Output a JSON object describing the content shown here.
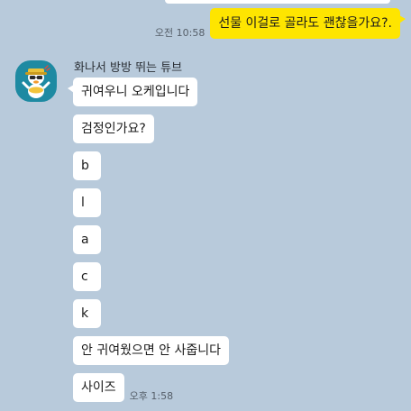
{
  "outgoing": {
    "time": "오전 10:58",
    "text": "선물 이걸로 골라도 괜찮을가요?."
  },
  "incoming": {
    "sender": "화나서 방방 뛰는 튜브",
    "avatar_icon": "tube-character-avatar-icon",
    "messages": [
      {
        "text": "귀여우니 오케입니다"
      },
      {
        "text": "검정인가요?"
      },
      {
        "text": "b"
      },
      {
        "text": "l"
      },
      {
        "text": "a"
      },
      {
        "text": "c"
      },
      {
        "text": "k"
      },
      {
        "text": "안 귀여웠으면 안 사줍니다"
      },
      {
        "text": "사이즈",
        "time": "오후 1:58"
      }
    ]
  },
  "colors": {
    "background": "#b8cadb",
    "outgoing_bubble": "#fee500",
    "incoming_bubble": "#ffffff",
    "avatar_bg": "#1e8aa2"
  }
}
